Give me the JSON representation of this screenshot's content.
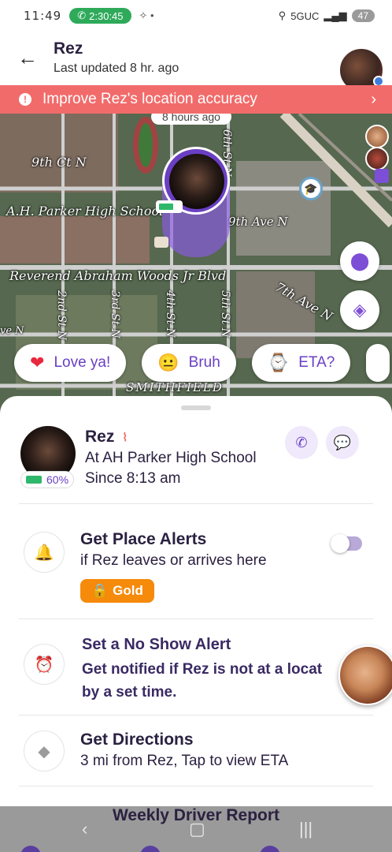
{
  "status_bar": {
    "time": "11:49",
    "call_timer": "2:30:45",
    "network": "5GUC",
    "battery": "47"
  },
  "header": {
    "name": "Rez",
    "subtitle": "Last updated 8 hr. ago"
  },
  "banner": {
    "text": "Improve Rez's location accuracy"
  },
  "map": {
    "time_bubble": "8 hours ago",
    "road_labels": {
      "ninth_ct": "9th Ct N",
      "school": "A.H. Parker High School",
      "ninth_ave": "9th Ave N",
      "reverend": "Reverend Abraham Woods Jr Blvd",
      "seventh_ave": "7th Ave N",
      "second_st": "2nd St N",
      "third_st": "3rd St N",
      "fourth_st": "4th St N",
      "fifth_st": "5th St N",
      "sixth_st": "6th St N",
      "ave_n": "ve N",
      "smithfield": "SMITHFIELD"
    }
  },
  "reactions": [
    {
      "emoji": "heart",
      "label": "Love ya!"
    },
    {
      "emoji": "neutral-face",
      "label": "Bruh"
    },
    {
      "emoji": "watch",
      "label": "ETA?"
    }
  ],
  "person": {
    "name": "Rez",
    "location": "At AH Parker High School",
    "since": "Since 8:13 am",
    "battery": "60%"
  },
  "place_alerts": {
    "title": "Get Place Alerts",
    "subtitle": "if Rez leaves or arrives here",
    "badge": "Gold"
  },
  "no_show": {
    "title": "Set a No Show Alert",
    "subtitle": "Get notified if Rez is not at a locat by a set time."
  },
  "directions": {
    "title": "Get Directions",
    "subtitle": "3 mi from Rez, Tap to view ETA"
  },
  "footer": {
    "weekly": "Weekly Driver Report"
  },
  "colors": {
    "accent": "#6a3fc4",
    "banner": "#f26b6b",
    "gold": "#f58a0b"
  }
}
